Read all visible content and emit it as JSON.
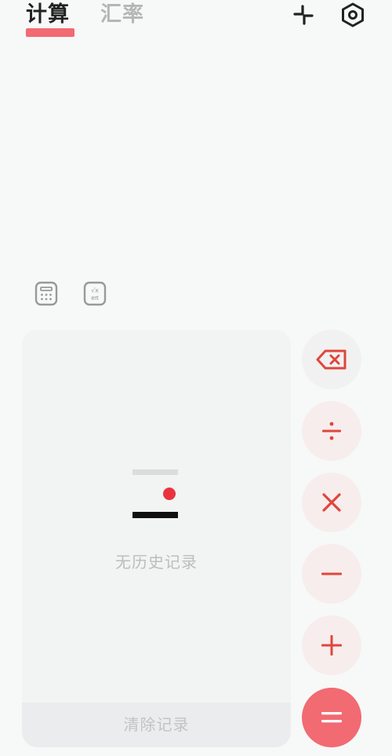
{
  "tabs": {
    "calculate": "计算",
    "exchange_rate": "汇率",
    "active": "calculate"
  },
  "toolbar": {
    "shrink_icon": "collapse-icon",
    "settings_icon": "settings-hex-icon"
  },
  "modes": {
    "basic_icon": "calculator-icon",
    "scientific_icon": "scientific-calculator-icon"
  },
  "history": {
    "empty_text": "无历史记录",
    "clear_label": "清除记录"
  },
  "operators": [
    "backspace",
    "÷",
    "×",
    "−",
    "+",
    "="
  ],
  "colors": {
    "accent": "#f26a72",
    "operator_text": "#e0463c",
    "operator_bg": "#f7eded",
    "background": "#f7f8f8"
  }
}
